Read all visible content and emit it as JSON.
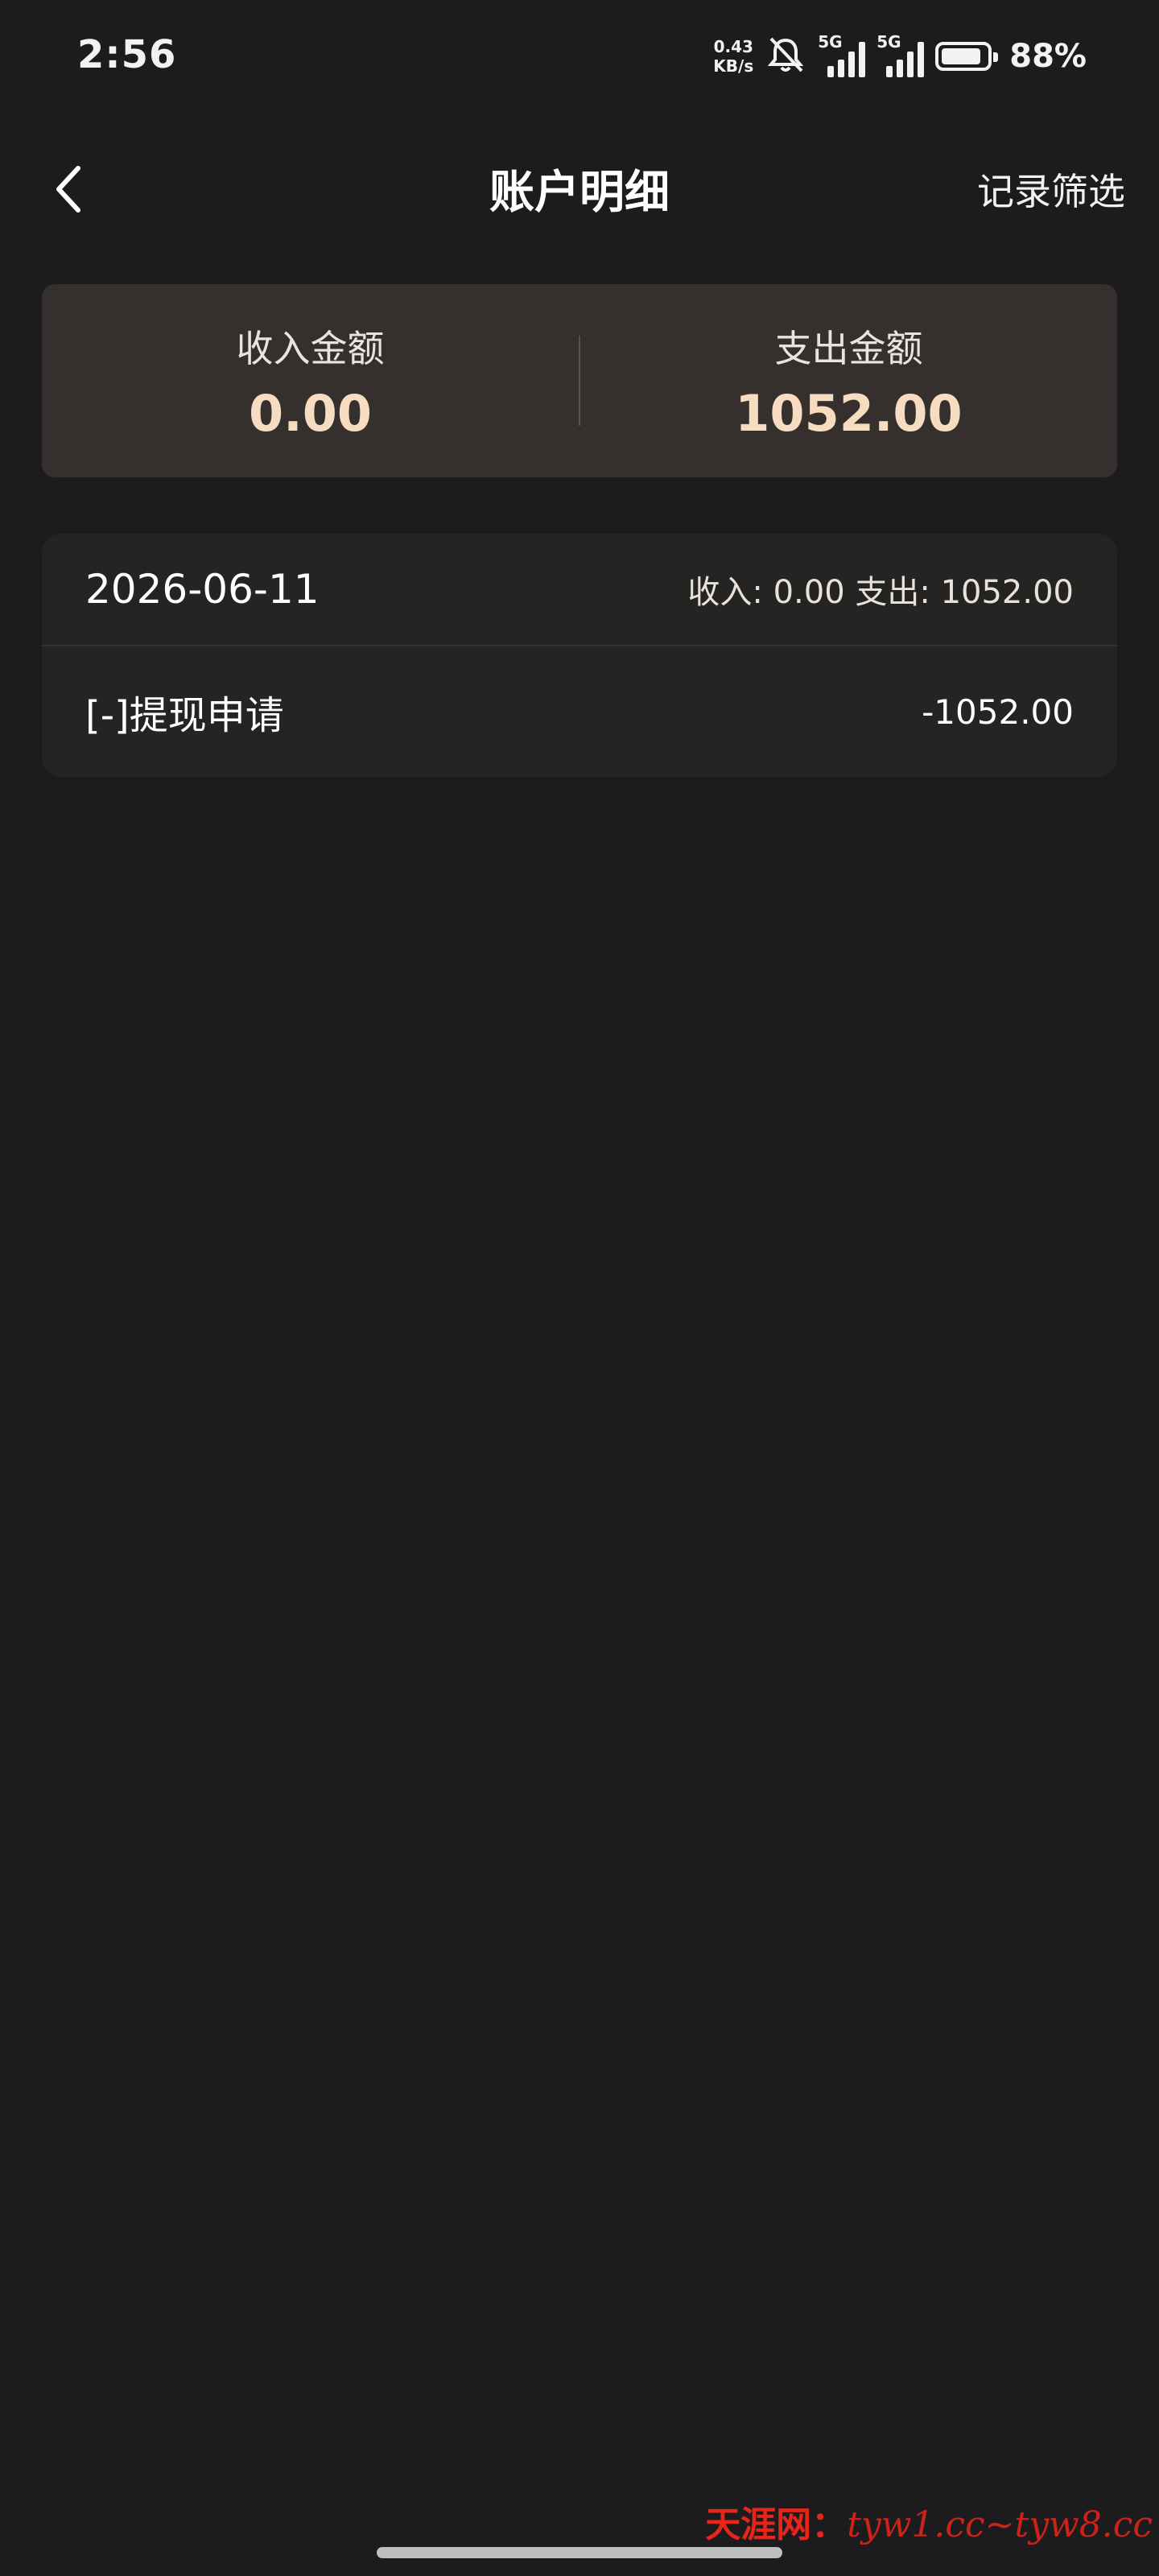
{
  "status_bar": {
    "time": "2:56",
    "net_speed_value": "0.43",
    "net_speed_unit": "KB/s",
    "signal_1_tag": "5G",
    "signal_2_tag": "5G",
    "battery_level": 0.88,
    "battery_text": "88%"
  },
  "header": {
    "title": "账户明细",
    "filter_label": "记录筛选"
  },
  "summary": {
    "income_label": "收入金额",
    "income_value": "0.00",
    "expense_label": "支出金额",
    "expense_value": "1052.00"
  },
  "records": {
    "groups": [
      {
        "date": "2026-06-11",
        "totals": "收入: 0.00 支出: 1052.00",
        "items": [
          {
            "title": "[-]提现申请",
            "amount": "-1052.00"
          }
        ]
      }
    ]
  },
  "watermark": {
    "zh": "天涯网：",
    "url": "tyw1.cc~tyw8.cc"
  },
  "colors": {
    "background": "#1c1c1e",
    "summary_card": "#35302d",
    "records_card": "#262422",
    "accent_amount": "#f6dcc0",
    "watermark": "#e8251a"
  }
}
